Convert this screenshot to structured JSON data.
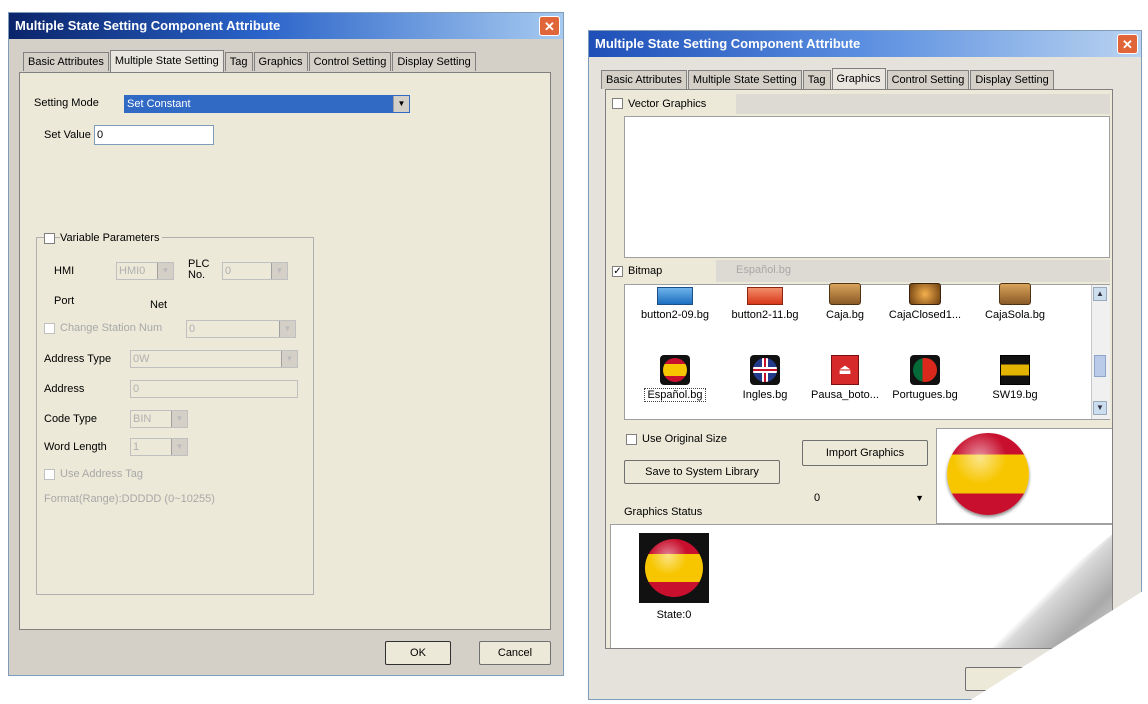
{
  "left_window": {
    "title": "Multiple State Setting Component Attribute",
    "close_glyph": "✕",
    "tabs": [
      "Basic Attributes",
      "Multiple State Setting",
      "Tag",
      "Graphics",
      "Control Setting",
      "Display Setting"
    ],
    "active_tab": "Multiple State Setting",
    "setting_mode_label": "Setting Mode",
    "setting_mode_value": "Set Constant",
    "set_value_label": "Set Value",
    "set_value": "0",
    "variable_parameters_label": "Variable Parameters",
    "hmi_label": "HMI",
    "hmi_value": "HMI0",
    "plc_no_label": "PLC No.",
    "plc_no_value": "0",
    "port_label": "Port",
    "net_label": "Net",
    "change_station_label": "Change Station Num",
    "change_station_value": "0",
    "address_type_label": "Address Type",
    "address_type_value": "0W",
    "address_label": "Address",
    "address_value": "0",
    "code_type_label": "Code Type",
    "code_type_value": "BIN",
    "word_length_label": "Word Length",
    "word_length_value": "1",
    "use_address_tag_label": "Use Address Tag",
    "range_text": "Format(Range):DDDDD (0~10255)",
    "ok_label": "OK",
    "cancel_label": "Cancel"
  },
  "right_window": {
    "title": "Multiple State Setting Component Attribute",
    "close_glyph": "✕",
    "tabs": [
      "Basic Attributes",
      "Multiple State Setting",
      "Tag",
      "Graphics",
      "Control Setting",
      "Display Setting"
    ],
    "active_tab": "Graphics",
    "vector_graphics_label": "Vector Graphics",
    "bitmap_label": "Bitmap",
    "bitmap_checked": true,
    "bitmap_file": "Español.bg",
    "thumbnails": [
      {
        "name": "button2-09.bg",
        "icon": "blue-button-icon"
      },
      {
        "name": "button2-11.bg",
        "icon": "red-button-icon"
      },
      {
        "name": "Caja.bg",
        "icon": "box-icon"
      },
      {
        "name": "CajaClosed1...",
        "icon": "closed-box-icon"
      },
      {
        "name": "CajaSola.bg",
        "icon": "box-icon"
      },
      {
        "name": "Español.bg",
        "icon": "spain-flag-icon",
        "selected": true
      },
      {
        "name": "Ingles.bg",
        "icon": "uk-flag-icon"
      },
      {
        "name": "Pausa_boto...",
        "icon": "eject-button-icon"
      },
      {
        "name": "Portugues.bg",
        "icon": "portugal-flag-icon"
      },
      {
        "name": "SW19.bg",
        "icon": "switch-icon"
      }
    ],
    "use_original_size_label": "Use Original Size",
    "import_graphics_label": "Import Graphics",
    "save_to_library_label": "Save to System Library",
    "state_dropdown_value": "0",
    "graphics_status_label": "Graphics Status",
    "state_label": "State:0"
  },
  "colors": {
    "title_start": "#0a246a",
    "title_end": "#a6caf0",
    "dialog_bg": "#d4d0c8",
    "panel_bg": "#ece9d8",
    "selection_blue": "#316ac5",
    "flag_red": "#c8102e",
    "flag_yellow": "#f7c600"
  }
}
